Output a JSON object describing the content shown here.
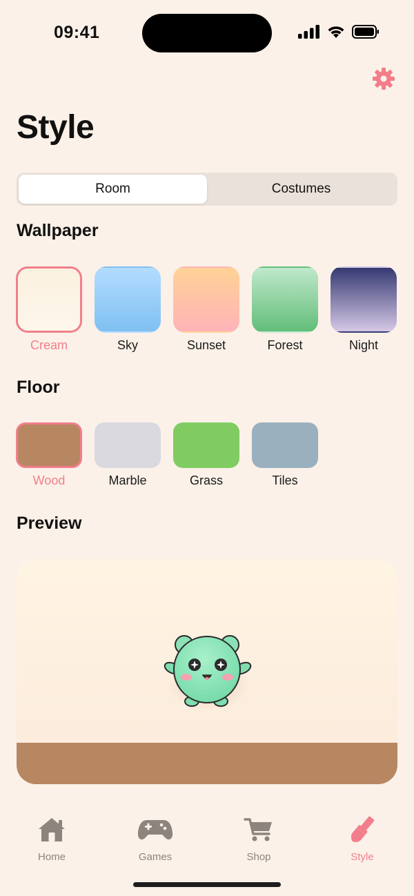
{
  "status_bar": {
    "time": "09:41"
  },
  "icons": {
    "settings": "gear-icon",
    "signal": "signal-icon",
    "wifi": "wifi-icon",
    "battery": "battery-icon"
  },
  "page_title": "Style",
  "segmented": {
    "room_label": "Room",
    "costumes_label": "Costumes",
    "selected": "Room"
  },
  "wallpaper": {
    "title": "Wallpaper",
    "selected": "Cream",
    "items": [
      {
        "label": "Cream",
        "colors": [
          "#FBF1E0",
          "#FDF6EA"
        ]
      },
      {
        "label": "Sky",
        "colors": [
          "#B3DCFF",
          "#7FC0F2"
        ]
      },
      {
        "label": "Sunset",
        "colors": [
          "#FFD296",
          "#FFB3B8"
        ]
      },
      {
        "label": "Forest",
        "colors": [
          "#BFE8CC",
          "#62BE78"
        ]
      },
      {
        "label": "Night",
        "colors": [
          "#353A72",
          "#D6C8E6"
        ]
      }
    ]
  },
  "floor": {
    "title": "Floor",
    "selected": "Wood",
    "items": [
      {
        "label": "Wood",
        "color": "#B78762"
      },
      {
        "label": "Marble",
        "color": "#D9D9DF"
      },
      {
        "label": "Grass",
        "color": "#80CC63"
      },
      {
        "label": "Tiles",
        "color": "#9AB0BF"
      }
    ]
  },
  "preview": {
    "title": "Preview",
    "pet": "green-bear-pet"
  },
  "tab_bar": {
    "tabs": [
      {
        "label": "Home",
        "icon": "house-icon"
      },
      {
        "label": "Games",
        "icon": "gamepad-icon"
      },
      {
        "label": "Shop",
        "icon": "cart-icon"
      },
      {
        "label": "Style",
        "icon": "paintbrush-icon"
      }
    ],
    "active": "Style"
  },
  "colors": {
    "accent": "#F27E8B",
    "background": "#FBF1E8",
    "tab_inactive": "#8C847D"
  }
}
